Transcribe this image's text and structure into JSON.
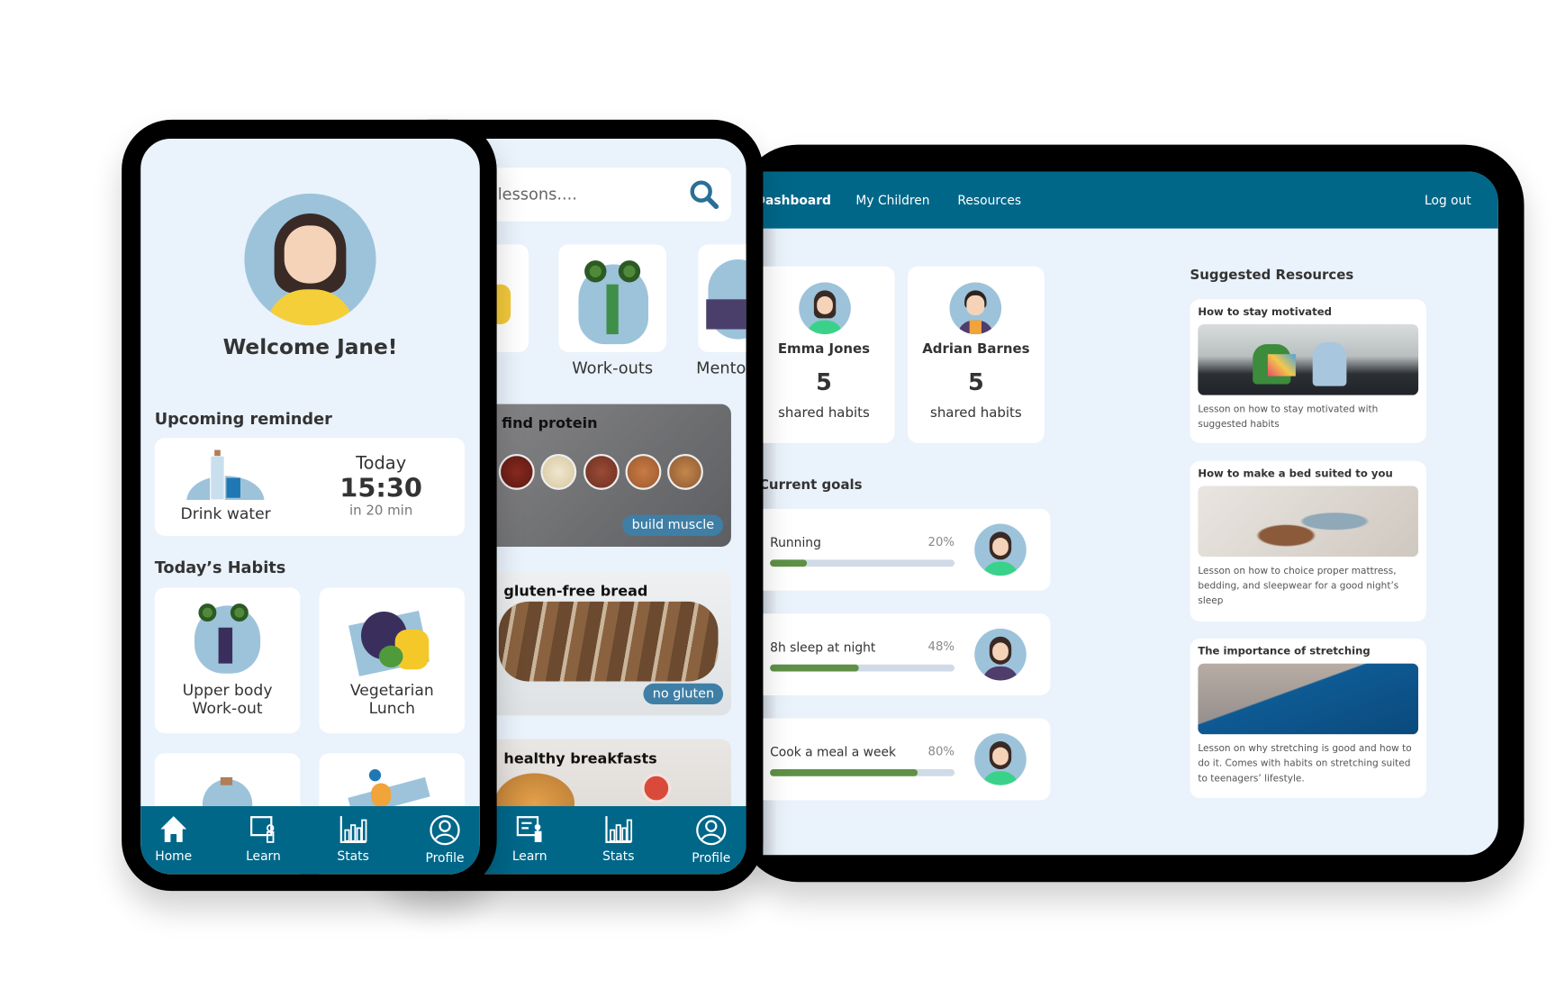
{
  "colors": {
    "primary": "#006789",
    "background": "#eaf2fb",
    "progress": "#5e9145",
    "tag": "#3f7fa6"
  },
  "phone_home": {
    "welcome": "Welcome Jane!",
    "reminder_heading": "Upcoming reminder",
    "reminder": {
      "label": "Drink water",
      "day": "Today",
      "time": "15:30",
      "countdown": "in 20 min",
      "icon": "water-bottle-icon"
    },
    "habits_heading": "Today’s Habits",
    "habits": [
      {
        "line1": "Upper body",
        "line2": "Work-out"
      },
      {
        "line1": "Vegetarian",
        "line2": "Lunch"
      }
    ],
    "nav": [
      {
        "label": "Home",
        "icon": "home-icon"
      },
      {
        "label": "Learn",
        "icon": "learn-icon"
      },
      {
        "label": "Stats",
        "icon": "stats-icon"
      },
      {
        "label": "Profile",
        "icon": "profile-icon"
      }
    ]
  },
  "phone_learn": {
    "search_placeholder": "lessons....",
    "categories": [
      "Work-outs",
      "Mento"
    ],
    "lessons": [
      {
        "title": "find protein",
        "tag": "build muscle"
      },
      {
        "title": "gluten-free bread",
        "tag": "no gluten"
      },
      {
        "title": "healthy breakfasts"
      }
    ],
    "nav": [
      {
        "label": "Learn"
      },
      {
        "label": "Stats"
      },
      {
        "label": "Profile"
      }
    ]
  },
  "tablet": {
    "nav": {
      "dashboard": "Dashboard",
      "children": "My Children",
      "resources": "Resources",
      "logout": "Log out"
    },
    "children": [
      {
        "name": "Emma Jones",
        "count": "5",
        "caption": "shared habits"
      },
      {
        "name": "Adrian Barnes",
        "count": "5",
        "caption": "shared habits"
      }
    ],
    "goals_heading": "Current goals",
    "goals": [
      {
        "label": "Running",
        "percent_label": "20%",
        "percent": 20
      },
      {
        "label": "8h sleep at night",
        "percent_label": "48%",
        "percent": 48
      },
      {
        "label": "Cook a meal a week",
        "percent_label": "80%",
        "percent": 80
      }
    ],
    "resources_heading": "Suggested Resources",
    "resources": [
      {
        "title": "How to stay motivated",
        "desc": "Lesson on how to stay motivated with suggested habits"
      },
      {
        "title": "How to make a bed suited to you",
        "desc": "Lesson on how to choice proper mattress, bedding, and sleepwear for a good night’s sleep"
      },
      {
        "title": "The importance of stretching",
        "desc": "Lesson on why stretching is good and how to do it. Comes with habits on stretching suited to teenagers’ lifestyle."
      }
    ]
  }
}
